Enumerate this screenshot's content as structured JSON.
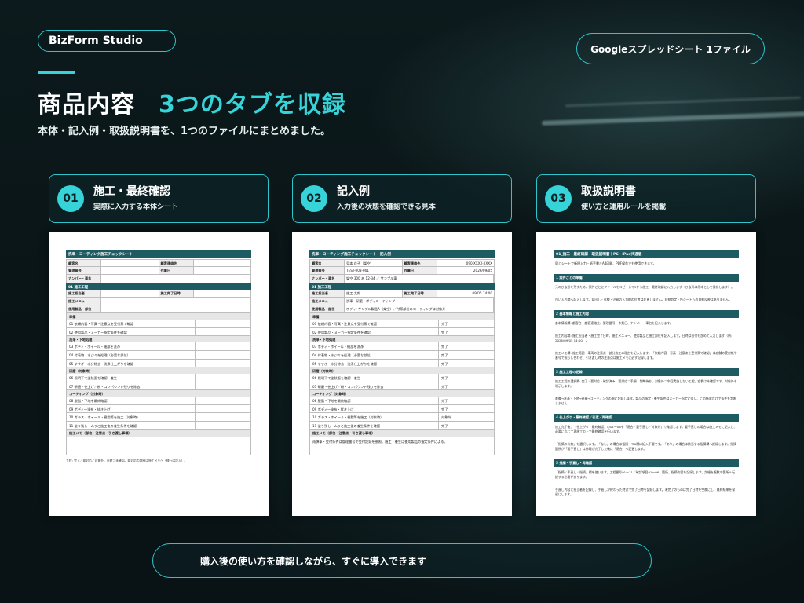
{
  "brand": "BizForm Studio",
  "top_badge": "Googleスプレッドシート 1ファイル",
  "headline": {
    "main": "商品内容",
    "accent": "3つのタブを収録"
  },
  "subline": "本体・記入例・取扱説明書を、1つのファイルにまとめました。",
  "tabs": [
    {
      "num": "01",
      "title": "施工・最終確認",
      "desc": "実際に入力する本体シート"
    },
    {
      "num": "02",
      "title": "記入例",
      "desc": "入力後の状態を確認できる見本"
    },
    {
      "num": "03",
      "title": "取扱説明書",
      "desc": "使い方と運用ルールを掲載"
    }
  ],
  "doc1": {
    "title": "洗車・コーティング施工チェックシート",
    "info": [
      {
        "k": "顧客名",
        "v": "",
        "k2": "顧客連絡先",
        "v2": ""
      },
      {
        "k": "管理番号",
        "v": "",
        "k2": "作業日",
        "v2": ""
      },
      {
        "k": "ナンバー・車名",
        "v": ""
      }
    ],
    "section1": "01 施工工程",
    "meta": [
      {
        "k": "施工担当者",
        "v": "",
        "k2": "施工完了日時",
        "v2": ""
      },
      {
        "k": "施工メニュー",
        "v": ""
      },
      {
        "k": "使用製品・部位",
        "v": ""
      }
    ],
    "groups": [
      {
        "label": "準備",
        "items": [
          "01 依頼内容・写真・注意点を受付票で確認",
          "02 使用製品・メーカー指定条件を確認"
        ]
      },
      {
        "label": "洗浄・下地処理",
        "items": [
          "03 ボディ・ホイール・細部を洗浄",
          "04 付着物・水ジミを処理（必要な部位）",
          "05 すすぎ・水分除去・洗浄仕上がりを確認"
        ]
      },
      {
        "label": "研磨（対象時）",
        "items": [
          "06 照明下で塗装面を確認・養生",
          "07 研磨・仕上げ／粉・コンパウンド残りを除去"
        ]
      },
      {
        "label": "コーティング（対象時）",
        "items": [
          "08 脱脂・下地を最終確認",
          "09 ボディ一塗布・拭き上げ",
          "10 ガラス・ホイール・樹脂等を施工（対象時）",
          "11 塗り残し・ムラと施工後の養生条件を確認"
        ]
      }
    ],
    "memo_label": "施工メモ（部位・注意点・引き渡し事項）",
    "footnote": "工程: 完了／要対応／対象外。日時＝未確認。要対応の詳細は施工メモへ（様行は記入）。"
  },
  "doc2": {
    "title": "洗車・コーティング施工チェックシート｜記入例",
    "info": [
      {
        "k": "顧客名",
        "v": "見本 花子（架空）",
        "k2": "顧客連絡先",
        "v2": "090-XXXX-XXXX"
      },
      {
        "k": "管理番号",
        "v": "TEST-003-001",
        "k2": "作業日",
        "v2": "2026/09/05"
      },
      {
        "k": "ナンバー・車名",
        "v": "架空 300 あ 12-34 ／ サンプル車"
      }
    ],
    "section1": "01 施工工程",
    "meta": [
      {
        "k": "施工担当者",
        "v": "施工 太郎",
        "k2": "施工完了日時",
        "v2": "09/05 14:00"
      },
      {
        "k": "施工メニュー",
        "v": "洗車・研磨・ボディコーティング"
      },
      {
        "k": "使用製品・部位",
        "v": "ボディ: サンプル製品A（架空）／付帯部位のコーティングは対象外"
      }
    ],
    "groups": [
      {
        "label": "準備",
        "items": [
          {
            "t": "01 依頼内容・写真・注意点を受付票で確認",
            "s": "完了"
          },
          {
            "t": "02 使用製品・メーカー指定条件を確認",
            "s": "完了"
          }
        ]
      },
      {
        "label": "洗浄・下地処理",
        "items": [
          {
            "t": "03 ボディ・ホイール・細部を洗浄",
            "s": "完了"
          },
          {
            "t": "04 付着物・水ジミを処理（必要な部位）",
            "s": "完了"
          },
          {
            "t": "05 すすぎ・水分除去・洗浄仕上がりを確認",
            "s": "完了"
          }
        ]
      },
      {
        "label": "研磨（対象時）",
        "items": [
          {
            "t": "06 照明下で塗装面を確認・養生",
            "s": "完了"
          },
          {
            "t": "07 研磨・仕上げ／粉・コンパウンド残りを除去",
            "s": "完了"
          }
        ]
      },
      {
        "label": "コーティング（対象時）",
        "items": [
          {
            "t": "08 脱脂・下地を最終確認",
            "s": "完了"
          },
          {
            "t": "09 ボディ一塗布・拭き上げ",
            "s": "完了"
          },
          {
            "t": "10 ガラス・ホイール・樹脂等を施工（対象時）",
            "s": "対象外"
          },
          {
            "t": "11 塗り残し・ムラと施工後の養生条件を確認",
            "s": "完了"
          }
        ]
      }
    ],
    "memo_label": "施工メモ（部位・注意点・引き渡し事項）",
    "memo_text": "雨弾車・受付条件は管理番号で受付記録を参照。施工・養生は使用製品の指定条件による。"
  },
  "doc3": {
    "title": "01_施工・最終確認　取扱説明書｜PC・iPad共通版",
    "intro": "同じシートで新規入力・紙手書きA4印刷、PDF保存でも使用できます。",
    "sections": [
      {
        "h": "1 案件ごとの準備",
        "p": [
          "元のひな形を残すため、案件ごとにファイルをコピーして5から施工・最終確認に入力します（ひな形は原本として保存します）。",
          "白い入力欄へ記入します。見出し・罫線・注意の入力欄の位置は変更しません。自動判定・色シートへの自動反映はありません。"
        ]
      },
      {
        "h": "2 基本情報と施工内容",
        "p": [
          "基本情報欄: 顧客名・顧客連絡先、管理番号・作業日、ナンバー・車名を記入します。",
          "施工内容欄: 施工担当者・施工完了日時、施工メニュー、使用製品と施工部位を記入します。日時は日付も含めて入力します（例: 2026/09/05 14:00）。",
          "施工メモ欄: 施工範囲・車両の注意点・部分施工の理由を記入します。「依頼内容・写真・注意点を受付票で確認」は店舗の受付帳や番号で照らし合わせ、引き渡し時の注意点は施工メモに必ず記録します。"
        ]
      },
      {
        "h": "3 施工工程の記録",
        "p": [
          "施工工程の選択欄: 完了／要対応・確認済み、要対応＝手順・判断待ち、対象外＝今回実施しない工程。空欄は未確認です。対象外も明示します。",
          "準備→洗浄・下地→研磨→コーティングの順に記録します。製品の指定・養生条件はメーカー指定に従い、この帳票だけで条件を判断しません。"
        ]
      },
      {
        "h": "4 仕上がり・最終確認／引渡／再確認",
        "p": [
          "施工完了後、「仕上がり・最終確認」の01〜06を「適合／要手直し／対象外」で確認します。要手直しの場合は施工メモに記入し、必要に応じて再施工の上で最終確認を行います。",
          "「指摘の有無」を選択します。「なし」の場合は指摘一つ0欄は記入不要です。「あり」の場合は該当する指摘欄へ記録します。指摘箇所が「要手直し」は修理が完了した後に「適合」へ変更します。"
        ]
      },
      {
        "h": "5 指摘・手直し・再確認",
        "p": [
          "「指摘／手直し／指摘」欄を使います。工程番号01〜11／確認項目01〜06、箇所、指摘内容を記録します。詳細を複数の箇所へ転記する必要があります。",
          "手直し内容と担当者を記録し、手直しが終わった時点で完了日時を記録します。未完了のものは完了日時を空欄にし、最終結果を保留にします。"
        ]
      }
    ]
  },
  "bottom": "購入後の使い方を確認しながら、すぐに導入できます",
  "colors": {
    "accent": "#36d4d8",
    "header": "#1e5b63",
    "bg": "#0b1719"
  }
}
